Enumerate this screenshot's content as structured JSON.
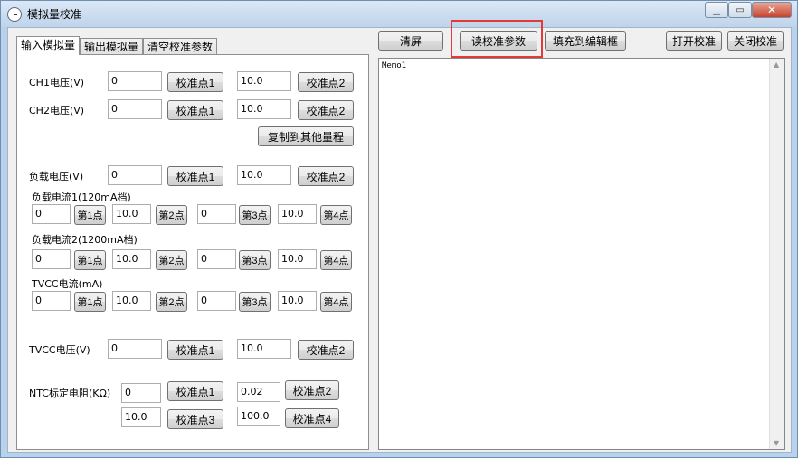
{
  "window": {
    "title": "模拟量校准"
  },
  "tabs": [
    "输入模拟量",
    "输出模拟量",
    "清空校准参数"
  ],
  "toolbar": {
    "clear": "清屏",
    "read_params": "读校准参数",
    "fill_editor": "填充到编辑框",
    "open_calib": "打开校准",
    "close_calib": "关闭校准"
  },
  "memo": {
    "text": "Memo1"
  },
  "inputs": {
    "ch1": {
      "label": "CH1电压(V)",
      "v1": "0",
      "btn1": "校准点1",
      "v2": "10.0",
      "btn2": "校准点2"
    },
    "ch2": {
      "label": "CH2电压(V)",
      "v1": "0",
      "btn1": "校准点1",
      "v2": "10.0",
      "btn2": "校准点2"
    },
    "copy": "复制到其他量程",
    "load_v": {
      "label": "负载电压(V)",
      "v1": "0",
      "btn1": "校准点1",
      "v2": "10.0",
      "btn2": "校准点2"
    },
    "load_i1": {
      "label": "负载电流1(120mA档)",
      "v1": "0",
      "b1": "第1点",
      "v2": "10.0",
      "b2": "第2点",
      "v3": "0",
      "b3": "第3点",
      "v4": "10.0",
      "b4": "第4点"
    },
    "load_i2": {
      "label": "负载电流2(1200mA档)",
      "v1": "0",
      "b1": "第1点",
      "v2": "10.0",
      "b2": "第2点",
      "v3": "0",
      "b3": "第3点",
      "v4": "10.0",
      "b4": "第4点"
    },
    "tvcc_i": {
      "label": "TVCC电流(mA)",
      "v1": "0",
      "b1": "第1点",
      "v2": "10.0",
      "b2": "第2点",
      "v3": "0",
      "b3": "第3点",
      "v4": "10.0",
      "b4": "第4点"
    },
    "tvcc_v": {
      "label": "TVCC电压(V)",
      "v1": "0",
      "btn1": "校准点1",
      "v2": "10.0",
      "btn2": "校准点2"
    },
    "ntc": {
      "label": "NTC标定电阻(KΩ)",
      "v1": "0",
      "btn1": "校准点1",
      "v2": "0.02",
      "btn2": "校准点2",
      "v3": "10.0",
      "btn3": "校准点3",
      "v4": "100.0",
      "btn4": "校准点4"
    }
  },
  "colors": {
    "highlight": "#e53935"
  }
}
